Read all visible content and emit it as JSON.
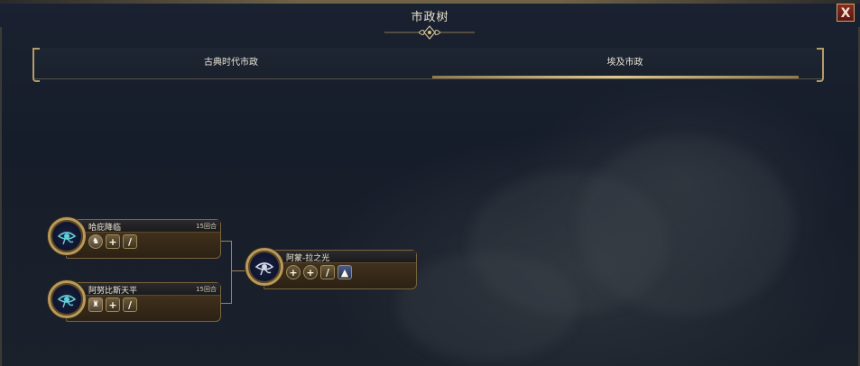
{
  "window": {
    "title": "市政树",
    "close_label": "X"
  },
  "tabs": [
    {
      "label": "古典时代市政",
      "active": false
    },
    {
      "label": "埃及市政",
      "active": true
    }
  ],
  "civics": [
    {
      "name": "哈庇降临",
      "turns": "15回合",
      "icons": [
        "unit-portrait-icon",
        "plus-icon",
        "feather-icon"
      ]
    },
    {
      "name": "阿努比斯天平",
      "turns": "15回合",
      "icons": [
        "building-portrait-icon",
        "plus-icon",
        "feather-icon"
      ]
    },
    {
      "name": "阿蒙-拉之光",
      "turns": "",
      "icons": [
        "plus-icon",
        "plus-icon",
        "feather-icon",
        "monument-icon"
      ]
    }
  ],
  "colors": {
    "accent_gold": "#c9a969",
    "close_red": "#8a2a22",
    "node_bg": "#2c2114"
  }
}
